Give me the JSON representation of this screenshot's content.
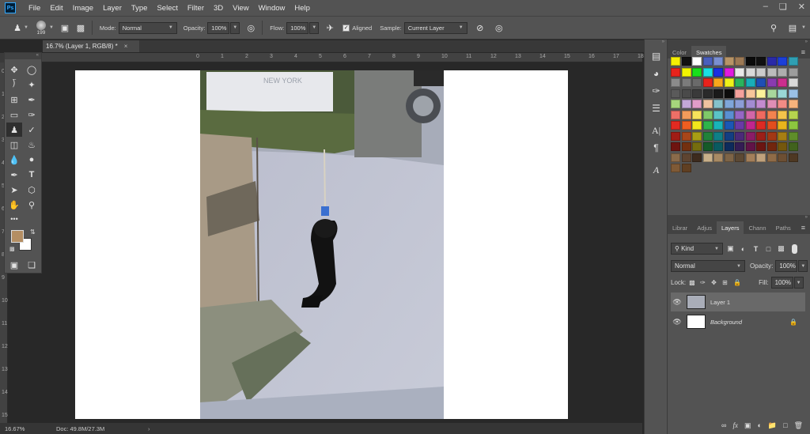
{
  "menubar": {
    "logo": "Ps",
    "items": [
      "File",
      "Edit",
      "Image",
      "Layer",
      "Type",
      "Select",
      "Filter",
      "3D",
      "View",
      "Window",
      "Help"
    ]
  },
  "options": {
    "brush_size": "199",
    "mode_label": "Mode:",
    "mode_value": "Normal",
    "opacity_label": "Opacity:",
    "opacity_value": "100%",
    "flow_label": "Flow:",
    "flow_value": "100%",
    "aligned_label": "Aligned",
    "aligned_checked": true,
    "sample_label": "Sample:",
    "sample_value": "Current Layer"
  },
  "document": {
    "tab_title": "16.7% (Layer 1, RGB/8) *",
    "tab_close": "×"
  },
  "rulers": {
    "top": [
      "0",
      "1",
      "2",
      "3",
      "4",
      "5",
      "6",
      "7",
      "8",
      "9",
      "10",
      "11",
      "12",
      "13",
      "14",
      "15",
      "16",
      "17",
      "18"
    ],
    "left": [
      "0",
      "1",
      "2",
      "3",
      "4",
      "5",
      "6",
      "7",
      "8",
      "9",
      "10",
      "11",
      "12",
      "13",
      "14",
      "15"
    ]
  },
  "status": {
    "zoom": "16.67%",
    "doc_info": "Doc: 49.8M/27.3M",
    "arrow": "›"
  },
  "toolbox": {
    "more": "•••"
  },
  "color_panel": {
    "tabs": [
      "Color",
      "Swatches"
    ],
    "active_tab": "Swatches",
    "swatches": [
      "#f5ee05",
      "#111111",
      "#ffffff",
      "#4a5fbd",
      "#7a8fd0",
      "#b79467",
      "#9c7955",
      "#0a0a0a",
      "#101010",
      "#2a2aa8",
      "#1c3fd8",
      "#2f9fb3",
      "#e8231c",
      "#f1f400",
      "#19e01b",
      "#19dfe4",
      "#1a2fe0",
      "#e01bde",
      "#e8e8e8",
      "#d9d9d9",
      "#cccccc",
      "#bcbcbc",
      "#adadad",
      "#9c9c9c",
      "#8b8b8b",
      "#7b7b7b",
      "#6a6a6a",
      "#e8231c",
      "#f7a71c",
      "#eef21a",
      "#2bb35c",
      "#19aeb8",
      "#1e4fb5",
      "#8a3bb0",
      "#cb2e8e",
      "#d9d9d9",
      "#5a5a5a",
      "#4a4a4a",
      "#3a3a3a",
      "#2a2a2a",
      "#1a1a1a",
      "#0c0c0c",
      "#f4a19c",
      "#f6c59a",
      "#fbf29a",
      "#a8d79c",
      "#99d7d6",
      "#9ac0e6",
      "#a6d67c",
      "#c3a7d8",
      "#e09cc8",
      "#f0c2a0",
      "#86c1cb",
      "#7fa6d9",
      "#8c9ed6",
      "#a28cd1",
      "#c38bcf",
      "#e08eb5",
      "#f28b85",
      "#f6b27c",
      "#ed6f67",
      "#f39b5b",
      "#f7e35b",
      "#7fc969",
      "#5bc3c7",
      "#5a8fd2",
      "#9667c4",
      "#d366a8",
      "#ef6a60",
      "#f2834f",
      "#f4c34b",
      "#b6d34e",
      "#e22a21",
      "#ef5e21",
      "#f2e61c",
      "#2fb34b",
      "#19b3b9",
      "#1b57b5",
      "#6a3aa5",
      "#c1268e",
      "#dd2b24",
      "#e24e1e",
      "#e9b41c",
      "#8cc63f",
      "#a01c15",
      "#a8461a",
      "#a89e14",
      "#21823a",
      "#0f7f87",
      "#133e82",
      "#4b2a78",
      "#8b1c66",
      "#9c1f18",
      "#a33814",
      "#a67e13",
      "#5f8d2a",
      "#6e1410",
      "#733010",
      "#756d0e",
      "#155a28",
      "#0a5a60",
      "#0e2b5c",
      "#341d54",
      "#611347",
      "#6b1511",
      "#72260d",
      "#74570d",
      "#41621d",
      "#8a6a4a",
      "#5e4430",
      "#3d2b1e",
      "#c9b08a",
      "#a88a64",
      "#7d6447",
      "#5c4934",
      "#a37f5a",
      "#c0a27d",
      "#8f6b47",
      "#6d4f33",
      "#4e3823",
      "#7f5a36",
      "#603f22"
    ]
  },
  "layers_panel": {
    "tabs": [
      "Librar",
      "Adjus",
      "Layers",
      "Chann",
      "Paths"
    ],
    "active_tab": "Layers",
    "filter_label": "Kind",
    "blend_mode": "Normal",
    "opacity_label": "Opacity:",
    "opacity_value": "100%",
    "lock_label": "Lock:",
    "fill_label": "Fill:",
    "fill_value": "100%",
    "layers": [
      {
        "name": "Layer 1",
        "selected": true
      },
      {
        "name": "Background",
        "selected": false,
        "locked": true
      }
    ]
  },
  "colors": {
    "foreground": "#b48e63",
    "background": "#ffffff",
    "panel": "#535353",
    "pasteboard": "#282828"
  }
}
